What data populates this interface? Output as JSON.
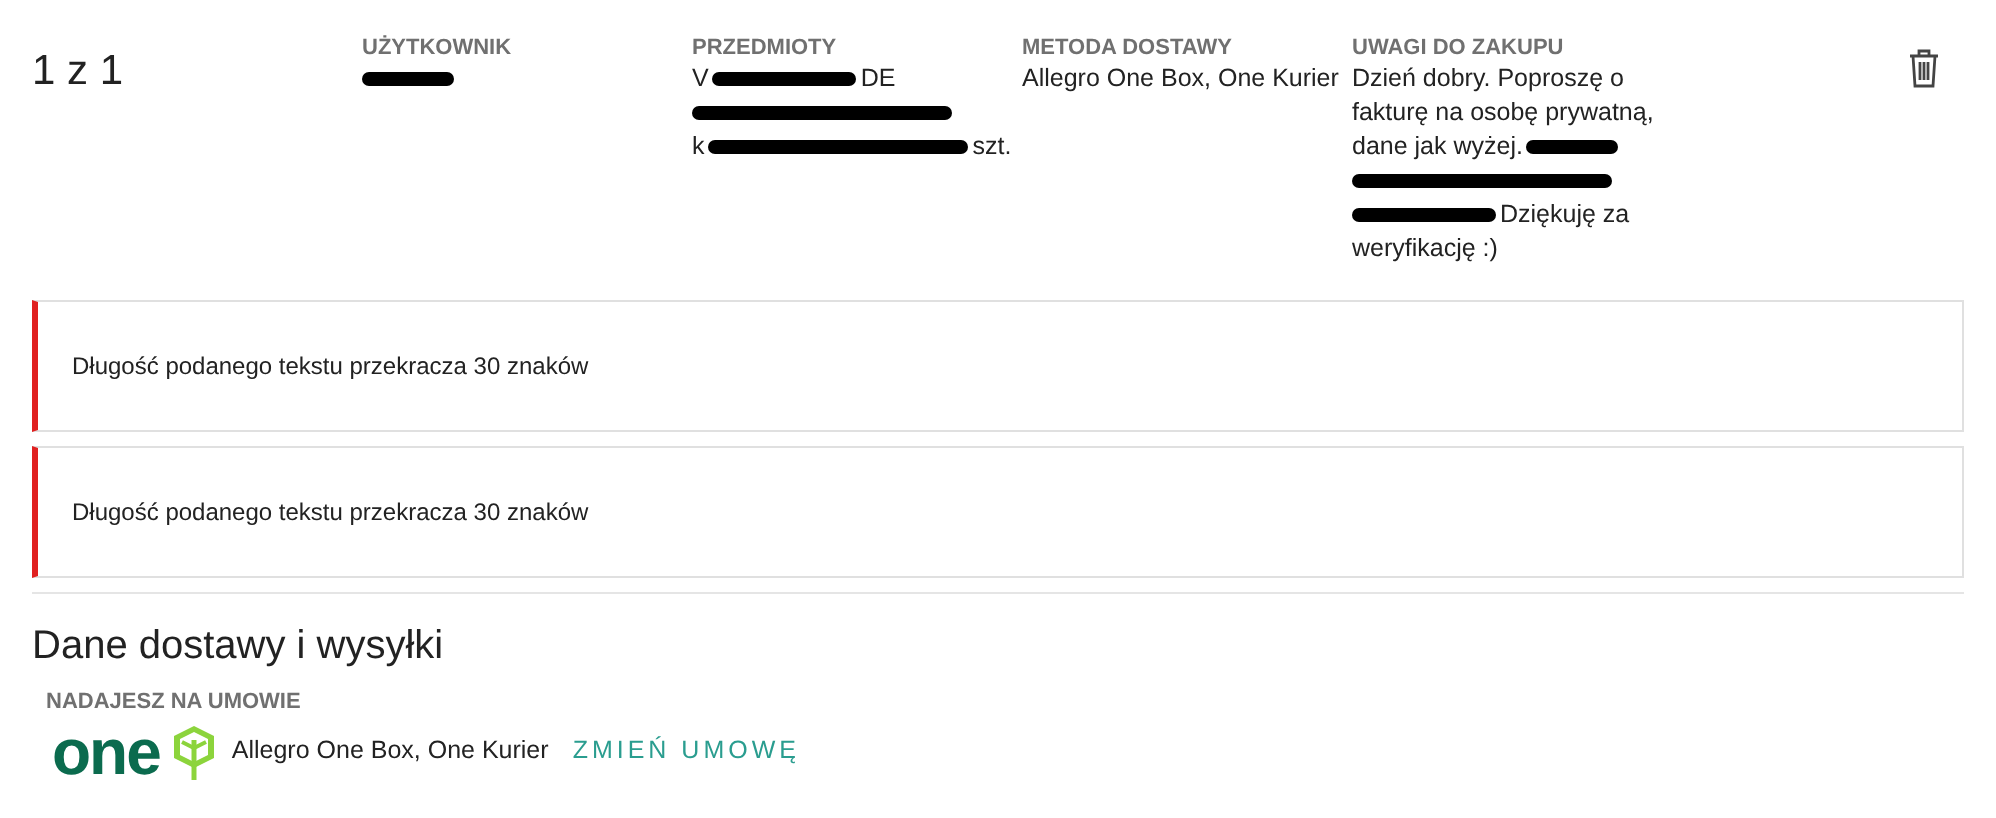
{
  "order": {
    "counter": "1 z 1",
    "columns": [
      {
        "label": "UŻYTKOWNIK",
        "lines": [
          [
            {
              "kind": "blot"
            }
          ]
        ]
      },
      {
        "label": "PRZEDMIOTY",
        "lines": [
          [
            {
              "kind": "text",
              "text": "V"
            },
            {
              "kind": "smear"
            },
            {
              "kind": "text",
              "text": "DE"
            }
          ],
          [
            {
              "kind": "strike"
            }
          ],
          [
            {
              "kind": "text",
              "text": "k"
            },
            {
              "kind": "strike"
            },
            {
              "kind": "text",
              "text": "szt."
            }
          ]
        ]
      },
      {
        "label": "METODA DOSTAWY",
        "lines": [
          [
            {
              "kind": "text",
              "text": "Allegro One Box, One Kurier"
            }
          ]
        ]
      },
      {
        "label": "UWAGI DO ZAKUPU",
        "lines": [
          [
            {
              "kind": "text",
              "text": "Dzień dobry. Poproszę o"
            }
          ],
          [
            {
              "kind": "text",
              "text": "fakturę na osobę prywatną,"
            }
          ],
          [
            {
              "kind": "text",
              "text": "dane jak wyżej."
            },
            {
              "kind": "blot"
            }
          ],
          [
            {
              "kind": "strike"
            }
          ],
          [
            {
              "kind": "smear"
            },
            {
              "kind": "text",
              "text": "Dziękuję za"
            }
          ],
          [
            {
              "kind": "text",
              "text": "weryfikację :)"
            }
          ]
        ]
      }
    ]
  },
  "errors": [
    "Długość podanego tekstu przekracza 30 znaków",
    "Długość podanego tekstu przekracza 30 znaków"
  ],
  "shipping": {
    "title": "Dane dostawy i wysyłki",
    "label": "NADAJESZ NA UMOWIE",
    "logo": "one",
    "contract": "Allegro One Box, One Kurier",
    "change_link": "ZMIEŃ UMOWĘ"
  }
}
